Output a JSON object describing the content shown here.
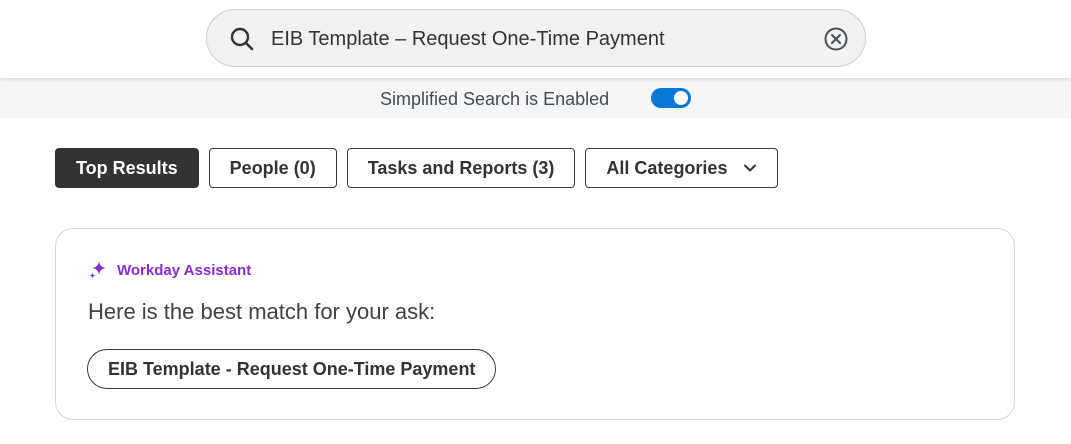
{
  "search": {
    "value": "EIB Template – Request One-Time Payment",
    "icon": "search-icon",
    "clear_icon": "clear-circle-icon"
  },
  "simplified_search": {
    "label": "Simplified Search is Enabled",
    "enabled": true
  },
  "filters": [
    {
      "label": "Top Results",
      "active": true
    },
    {
      "label": "People (0)",
      "active": false
    },
    {
      "label": "Tasks and Reports (3)",
      "active": false
    },
    {
      "label": "All Categories",
      "active": false,
      "icon": "chevron-down-icon"
    }
  ],
  "assistant": {
    "name": "Workday Assistant",
    "icon": "sparkle-icon",
    "message": "Here is the best match for your ask:",
    "match_label": "EIB Template - Request One-Time Payment"
  },
  "colors": {
    "accent_blue": "#0b77d6",
    "assistant_purple": "#8a2ccf",
    "active_tab": "#333333"
  }
}
